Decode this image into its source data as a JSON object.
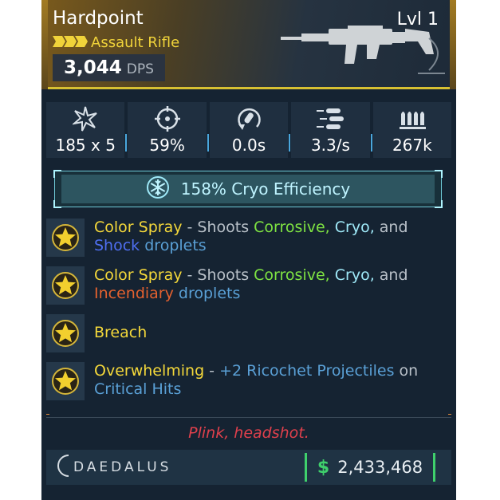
{
  "weapon": {
    "name": "Hardpoint",
    "level": "Lvl 1",
    "type": "Assault Rifle",
    "dps_value": "3,044",
    "dps_unit": "DPS",
    "rarity_color": "#f0d33a",
    "icon": "assault-rifle-silhouette"
  },
  "stats": [
    {
      "icon": "damage-icon",
      "value": "185 x 5"
    },
    {
      "icon": "accuracy-icon",
      "value": "59%"
    },
    {
      "icon": "reload-icon",
      "value": "0.0s"
    },
    {
      "icon": "fire-rate-icon",
      "value": "3.3/s"
    },
    {
      "icon": "magazine-icon",
      "value": "267k"
    }
  ],
  "element": {
    "icon": "cryo-snowflake-icon",
    "label": "158% Cryo Efficiency",
    "color": "#bff4ff"
  },
  "perks": [
    {
      "icon": "star-badge-icon",
      "segments": [
        {
          "text": "Color Spray",
          "color": "yellow"
        },
        {
          "text": " - Shoots ",
          "color": "grey"
        },
        {
          "text": "Corrosive,",
          "color": "green"
        },
        {
          "text": " ",
          "color": "grey"
        },
        {
          "text": "Cryo,",
          "color": "cyan"
        },
        {
          "text": " and ",
          "color": "grey"
        },
        {
          "text": "Shock",
          "color": "blue"
        },
        {
          "text": " ",
          "color": "grey"
        },
        {
          "text": "droplets",
          "color": "sky"
        }
      ]
    },
    {
      "icon": "star-badge-icon",
      "segments": [
        {
          "text": "Color Spray",
          "color": "yellow"
        },
        {
          "text": " - Shoots ",
          "color": "grey"
        },
        {
          "text": "Corrosive,",
          "color": "green"
        },
        {
          "text": " ",
          "color": "grey"
        },
        {
          "text": "Cryo,",
          "color": "cyan"
        },
        {
          "text": " and ",
          "color": "grey"
        },
        {
          "text": "Incendiary",
          "color": "orange"
        },
        {
          "text": " ",
          "color": "grey"
        },
        {
          "text": "droplets",
          "color": "sky"
        }
      ]
    },
    {
      "icon": "star-badge-icon",
      "segments": [
        {
          "text": "Breach",
          "color": "yellow"
        }
      ]
    },
    {
      "icon": "star-badge-icon",
      "segments": [
        {
          "text": "Overwhelming",
          "color": "yellow"
        },
        {
          "text": " - ",
          "color": "grey"
        },
        {
          "text": "+2 Ricochet Projectiles",
          "color": "sky"
        },
        {
          "text": " on ",
          "color": "grey"
        },
        {
          "text": "Critical Hits",
          "color": "sky"
        }
      ]
    }
  ],
  "flavor_text": "Plink, headshot.",
  "manufacturer": {
    "name": "DAEDALUS",
    "icon": "daedalus-logo"
  },
  "price": {
    "icon": "dollar-icon",
    "symbol": "$",
    "value": "2,433,468",
    "color": "#3fd06c"
  }
}
